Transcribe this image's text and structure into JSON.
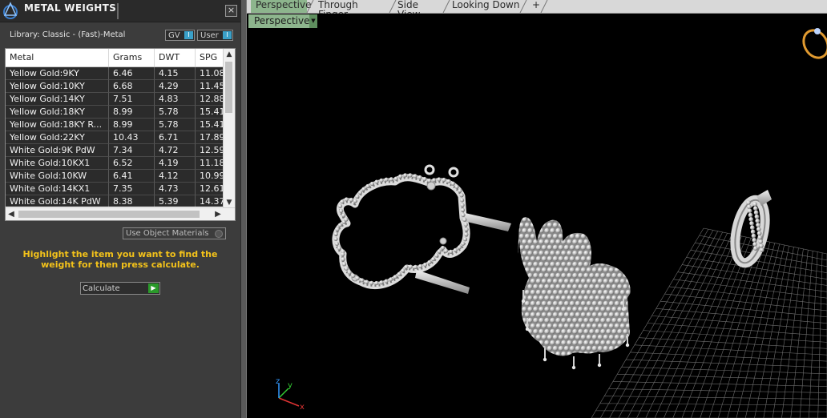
{
  "panel": {
    "title": "METAL WEIGHTS",
    "close_glyph": "×",
    "library_label": "Library: Classic - (Fast)-Metal",
    "toggle_gv": "GV",
    "toggle_user": "User",
    "columns": [
      "Metal",
      "Grams",
      "DWT",
      "SPG"
    ],
    "rows": [
      [
        "Yellow Gold:9KY",
        "6.46",
        "4.15",
        "11.08"
      ],
      [
        "Yellow Gold:10KY",
        "6.68",
        "4.29",
        "11.45"
      ],
      [
        "Yellow Gold:14KY",
        "7.51",
        "4.83",
        "12.88"
      ],
      [
        "Yellow Gold:18KY",
        "8.99",
        "5.78",
        "15.41"
      ],
      [
        "Yellow Gold:18KY R...",
        "8.99",
        "5.78",
        "15.41"
      ],
      [
        "Yellow Gold:22KY",
        "10.43",
        "6.71",
        "17.89"
      ],
      [
        "White Gold:9K PdW",
        "7.34",
        "4.72",
        "12.59"
      ],
      [
        "White Gold:10KX1",
        "6.52",
        "4.19",
        "11.18"
      ],
      [
        "White Gold:10KW",
        "6.41",
        "4.12",
        "10.99"
      ],
      [
        "White Gold:14KX1",
        "7.35",
        "4.73",
        "12.61"
      ],
      [
        "White Gold:14K PdW",
        "8.38",
        "5.39",
        "14.37"
      ]
    ],
    "use_object_materials": "Use Object Materials",
    "hint": "Highlight the item you want to find the weight for then press calculate.",
    "calculate_label": "Calculate"
  },
  "viewport": {
    "tabs": [
      "Perspective",
      "Through Finger",
      "Side View",
      "Looking Down"
    ],
    "add_tab_glyph": "+",
    "view_button": "Perspective",
    "axis_labels": {
      "x": "x",
      "y": "y",
      "z": "z"
    }
  },
  "colors": {
    "hint_text": "#f3c21a",
    "active_tab": "#8db58d",
    "viewport_bg": "#000000"
  }
}
